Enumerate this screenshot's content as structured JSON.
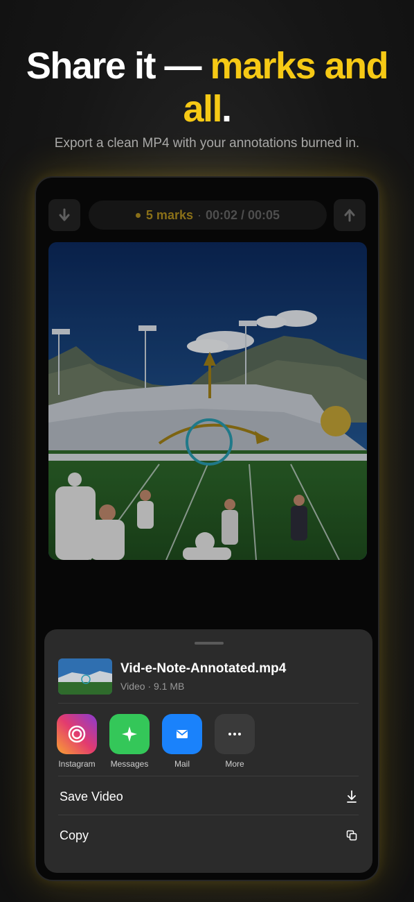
{
  "headline": {
    "part1": "Share it — ",
    "accent": "marks and all",
    "end": "."
  },
  "subtitle": "Export a clean MP4 with your annotations burned in.",
  "player": {
    "marks_label": "5 marks",
    "separator": "·",
    "time": "00:02 / 00:05",
    "left_icon": "arrow-down-icon",
    "right_icon": "arrow-up-icon"
  },
  "share_sheet": {
    "file_name": "Vid-e-Note-Annotated.mp4",
    "file_meta": "Video · 9.1 MB",
    "apps": [
      {
        "label": "Instagram",
        "icon": "instagram-icon",
        "color": "#c13584"
      },
      {
        "label": "Messages",
        "icon": "messages-icon",
        "color": "#34c759"
      },
      {
        "label": "Mail",
        "icon": "mail-icon",
        "color": "#1a82fb"
      },
      {
        "label": "More",
        "icon": "more-icon",
        "color": "#3a3a3a"
      }
    ],
    "actions": [
      {
        "label": "Save Video",
        "icon": "download-icon"
      },
      {
        "label": "Copy",
        "icon": "copy-icon"
      }
    ]
  },
  "colors": {
    "accent": "#f6c915",
    "background": "#141414",
    "sheet": "#2b2b2b"
  }
}
